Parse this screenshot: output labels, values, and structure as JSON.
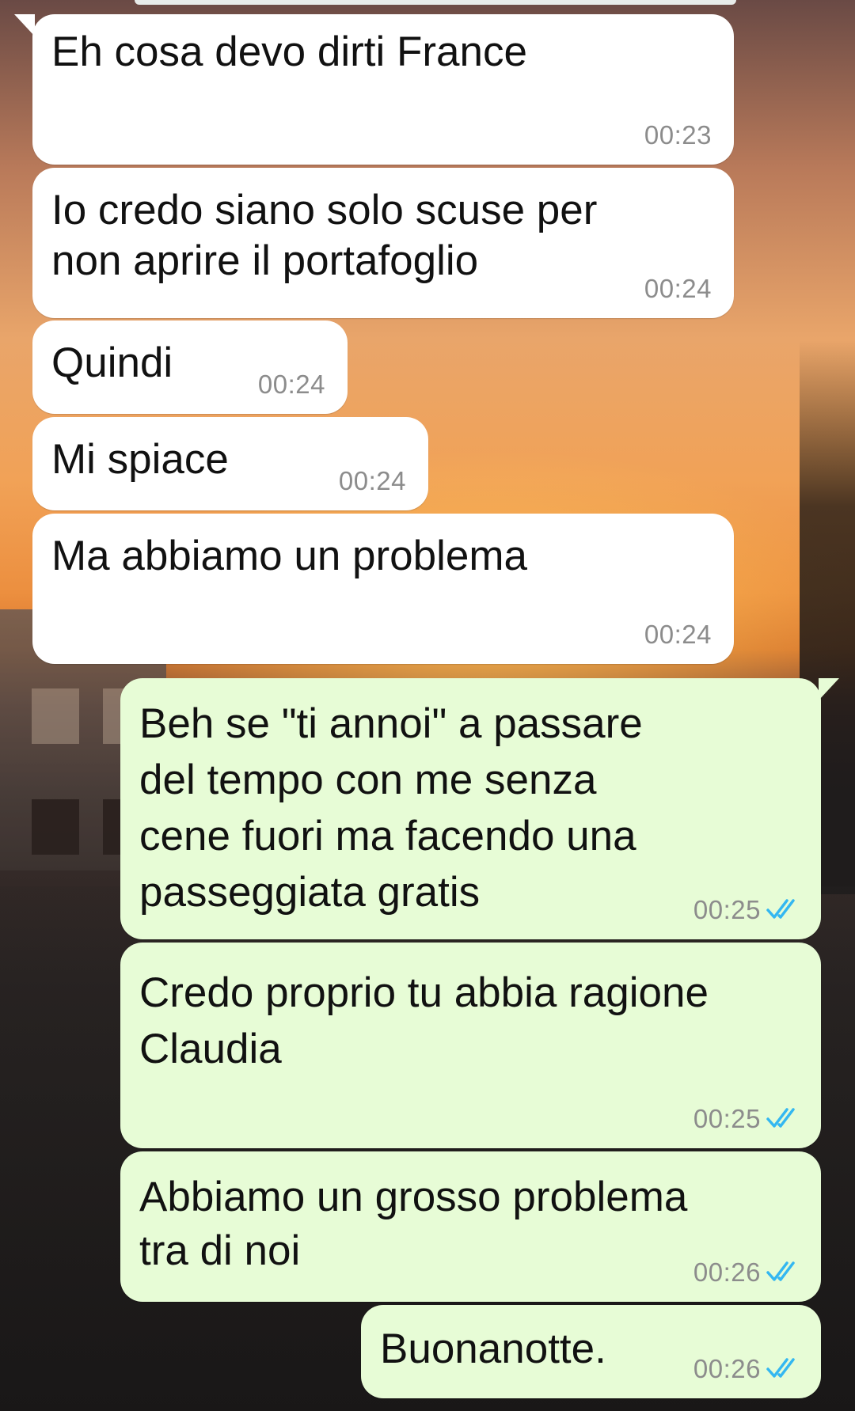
{
  "chat": {
    "messages": [
      {
        "direction": "incoming",
        "text": "Eh cosa devo dirti France",
        "time": "00:23"
      },
      {
        "direction": "incoming",
        "text": "Io credo siano solo scuse per\nnon aprire il portafoglio",
        "time": "00:24"
      },
      {
        "direction": "incoming",
        "text": "Quindi",
        "time": "00:24"
      },
      {
        "direction": "incoming",
        "text": "Mi spiace",
        "time": "00:24"
      },
      {
        "direction": "incoming",
        "text": "Ma abbiamo un problema",
        "time": "00:24"
      },
      {
        "direction": "outgoing",
        "text": "Beh se \"ti annoi\" a passare\ndel tempo con me senza\ncene fuori ma facendo una\npasseggiata gratis",
        "time": "00:25",
        "status": "read"
      },
      {
        "direction": "outgoing",
        "text": "Credo proprio tu abbia ragione\nClaudia",
        "time": "00:25",
        "status": "read"
      },
      {
        "direction": "outgoing",
        "text": "Abbiamo un grosso problema\ntra di noi",
        "time": "00:26",
        "status": "read"
      },
      {
        "direction": "outgoing",
        "text": "Buonanotte.",
        "time": "00:26",
        "status": "read"
      }
    ]
  },
  "colors": {
    "incoming_bubble": "#ffffff",
    "outgoing_bubble": "#e7fcd6",
    "read_ticks": "#34b7f1",
    "timestamp": "#8c8c8c"
  },
  "icons": {
    "read_receipt": "double-check-icon"
  }
}
